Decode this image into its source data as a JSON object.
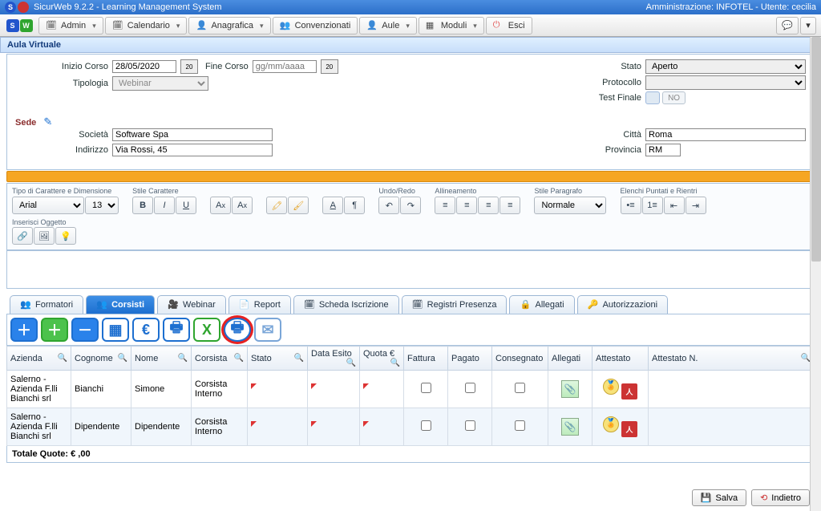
{
  "titlebar": {
    "app": "SicurWeb 9.2.2 - Learning Management System",
    "right": "Amministrazione: INFOTEL - Utente: cecilia"
  },
  "menu": {
    "admin": "Admin",
    "calendario": "Calendario",
    "anagrafica": "Anagrafica",
    "convenzionati": "Convenzionati",
    "aule": "Aule",
    "moduli": "Moduli",
    "esci": "Esci"
  },
  "page_title": "Aula Virtuale",
  "form": {
    "inizio_corso_lbl": "Inizio Corso",
    "inizio_corso": "28/05/2020",
    "fine_corso_lbl": "Fine Corso",
    "fine_corso_ph": "gg/mm/aaaa",
    "tipologia_lbl": "Tipologia",
    "tipologia": "Webinar",
    "stato_lbl": "Stato",
    "stato": "Aperto",
    "protocollo_lbl": "Protocollo",
    "protocollo": "",
    "test_finale_lbl": "Test Finale",
    "test_toggle": "NO",
    "sede_lbl": "Sede",
    "societa_lbl": "Società",
    "societa": "Software Spa",
    "indirizzo_lbl": "Indirizzo",
    "indirizzo": "Via Rossi, 45",
    "citta_lbl": "Città",
    "citta": "Roma",
    "provincia_lbl": "Provincia",
    "provincia": "RM"
  },
  "rte": {
    "font_lbl": "Tipo di Carattere e Dimensione",
    "font": "Arial",
    "size": "13",
    "style_lbl": "Stile Carattere",
    "undo_lbl": "Undo/Redo",
    "align_lbl": "Allineamento",
    "para_lbl": "Stile Paragrafo",
    "para": "Normale",
    "list_lbl": "Elenchi Puntati e Rientri",
    "insert_lbl": "Inserisci Oggetto"
  },
  "tabs": {
    "formatori": "Formatori",
    "corsisti": "Corsisti",
    "webinar": "Webinar",
    "report": "Report",
    "scheda": "Scheda Iscrizione",
    "registri": "Registri Presenza",
    "allegati": "Allegati",
    "autorizz": "Autorizzazioni"
  },
  "columns": {
    "azienda": "Azienda",
    "cognome": "Cognome",
    "nome": "Nome",
    "corsista": "Corsista",
    "stato": "Stato",
    "data_esito": "Data Esito",
    "quota": "Quota €",
    "fattura": "Fattura",
    "pagato": "Pagato",
    "consegnato": "Consegnato",
    "allegati": "Allegati",
    "attestato": "Attestato",
    "attestato_n": "Attestato N."
  },
  "rows": [
    {
      "azienda": "Salerno - Azienda F.lli Bianchi srl",
      "cognome": "Bianchi",
      "nome": "Simone",
      "corsista": "Corsista Interno"
    },
    {
      "azienda": "Salerno - Azienda F.lli Bianchi srl",
      "cognome": "Dipendente",
      "nome": "Dipendente",
      "corsista": "Corsista Interno"
    }
  ],
  "total": "Totale Quote: € ,00",
  "footer": {
    "salva": "Salva",
    "indietro": "Indietro"
  }
}
